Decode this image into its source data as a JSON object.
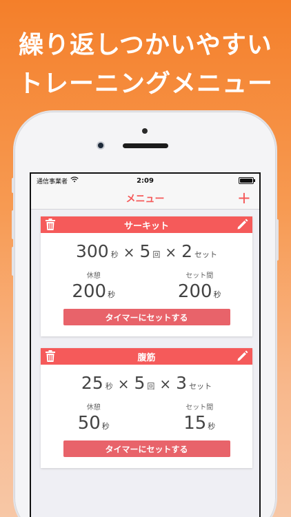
{
  "headline": {
    "line1": "繰り返しつかいやすい",
    "line2": "トレーニングメニュー"
  },
  "status_bar": {
    "carrier": "通信事業者",
    "time": "2:09"
  },
  "navbar": {
    "title": "メニュー",
    "add_label": "+"
  },
  "icons": {
    "delete": "trash-icon",
    "edit": "pencil-icon",
    "wifi": "wifi-icon",
    "battery": "battery-icon"
  },
  "colors": {
    "accent": "#F55A5A",
    "button": "#E8636A",
    "background_top": "#F47F2A",
    "background_bottom": "#F7C7A6"
  },
  "menus": [
    {
      "name": "サーキット",
      "work": "300",
      "work_unit": "秒",
      "times_sign": "×",
      "reps": "5",
      "reps_unit": "回",
      "sets": "2",
      "sets_unit": "セット",
      "rest_label": "休憩",
      "rest_value": "200",
      "rest_unit": "秒",
      "interval_label": "セット間",
      "interval_value": "200",
      "interval_unit": "秒",
      "button_label": "タイマーにセットする"
    },
    {
      "name": "腹筋",
      "work": "25",
      "work_unit": "秒",
      "times_sign": "×",
      "reps": "5",
      "reps_unit": "回",
      "sets": "3",
      "sets_unit": "セット",
      "rest_label": "休憩",
      "rest_value": "50",
      "rest_unit": "秒",
      "interval_label": "セット間",
      "interval_value": "15",
      "interval_unit": "秒",
      "button_label": "タイマーにセットする"
    }
  ]
}
